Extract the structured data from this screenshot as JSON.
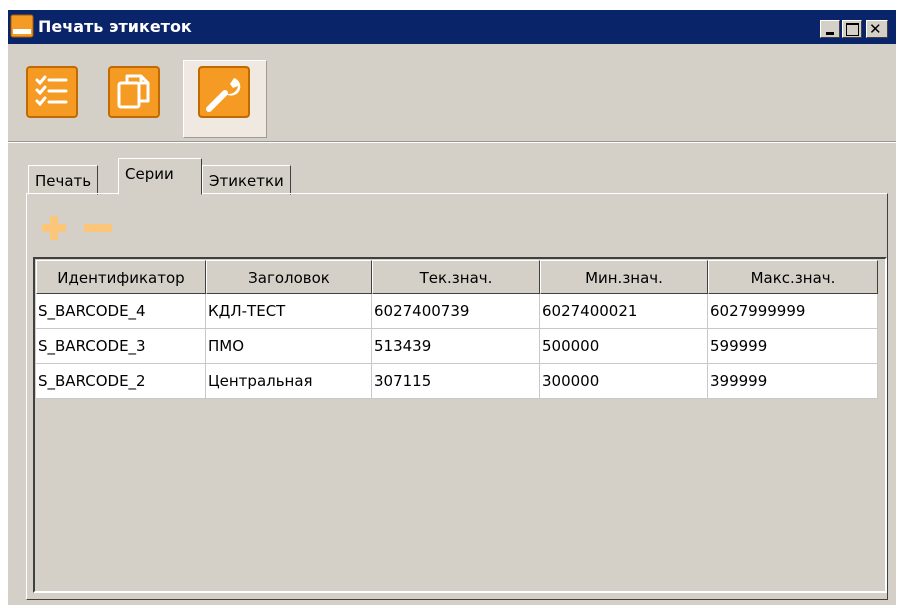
{
  "window": {
    "title": "Печать этикеток"
  },
  "toolbar": {
    "items": [
      {
        "icon": "checklist-icon"
      },
      {
        "icon": "copy-icon"
      },
      {
        "icon": "wrench-icon",
        "active": true
      }
    ]
  },
  "tabs": [
    {
      "label": "Печать"
    },
    {
      "label": "Серии",
      "active": true
    },
    {
      "label": "Этикетки"
    }
  ],
  "actions": {
    "add_icon": "plus-icon",
    "remove_icon": "minus-icon",
    "disabled": true
  },
  "table": {
    "columns": [
      "Идентификатор",
      "Заголовок",
      "Тек.знач.",
      "Мин.знач.",
      "Макс.знач."
    ],
    "rows": [
      [
        "S_BARCODE_4",
        "КДЛ-ТЕСТ",
        "6027400739",
        "6027400021",
        "6027999999"
      ],
      [
        "S_BARCODE_3",
        "ПМО",
        "513439",
        "500000",
        "599999"
      ],
      [
        "S_BARCODE_2",
        "Центральная",
        "307115",
        "300000",
        "399999"
      ]
    ]
  },
  "colors": {
    "titlebar": "#0a246a",
    "accent": "#f59a23",
    "face": "#d4d0c8"
  }
}
